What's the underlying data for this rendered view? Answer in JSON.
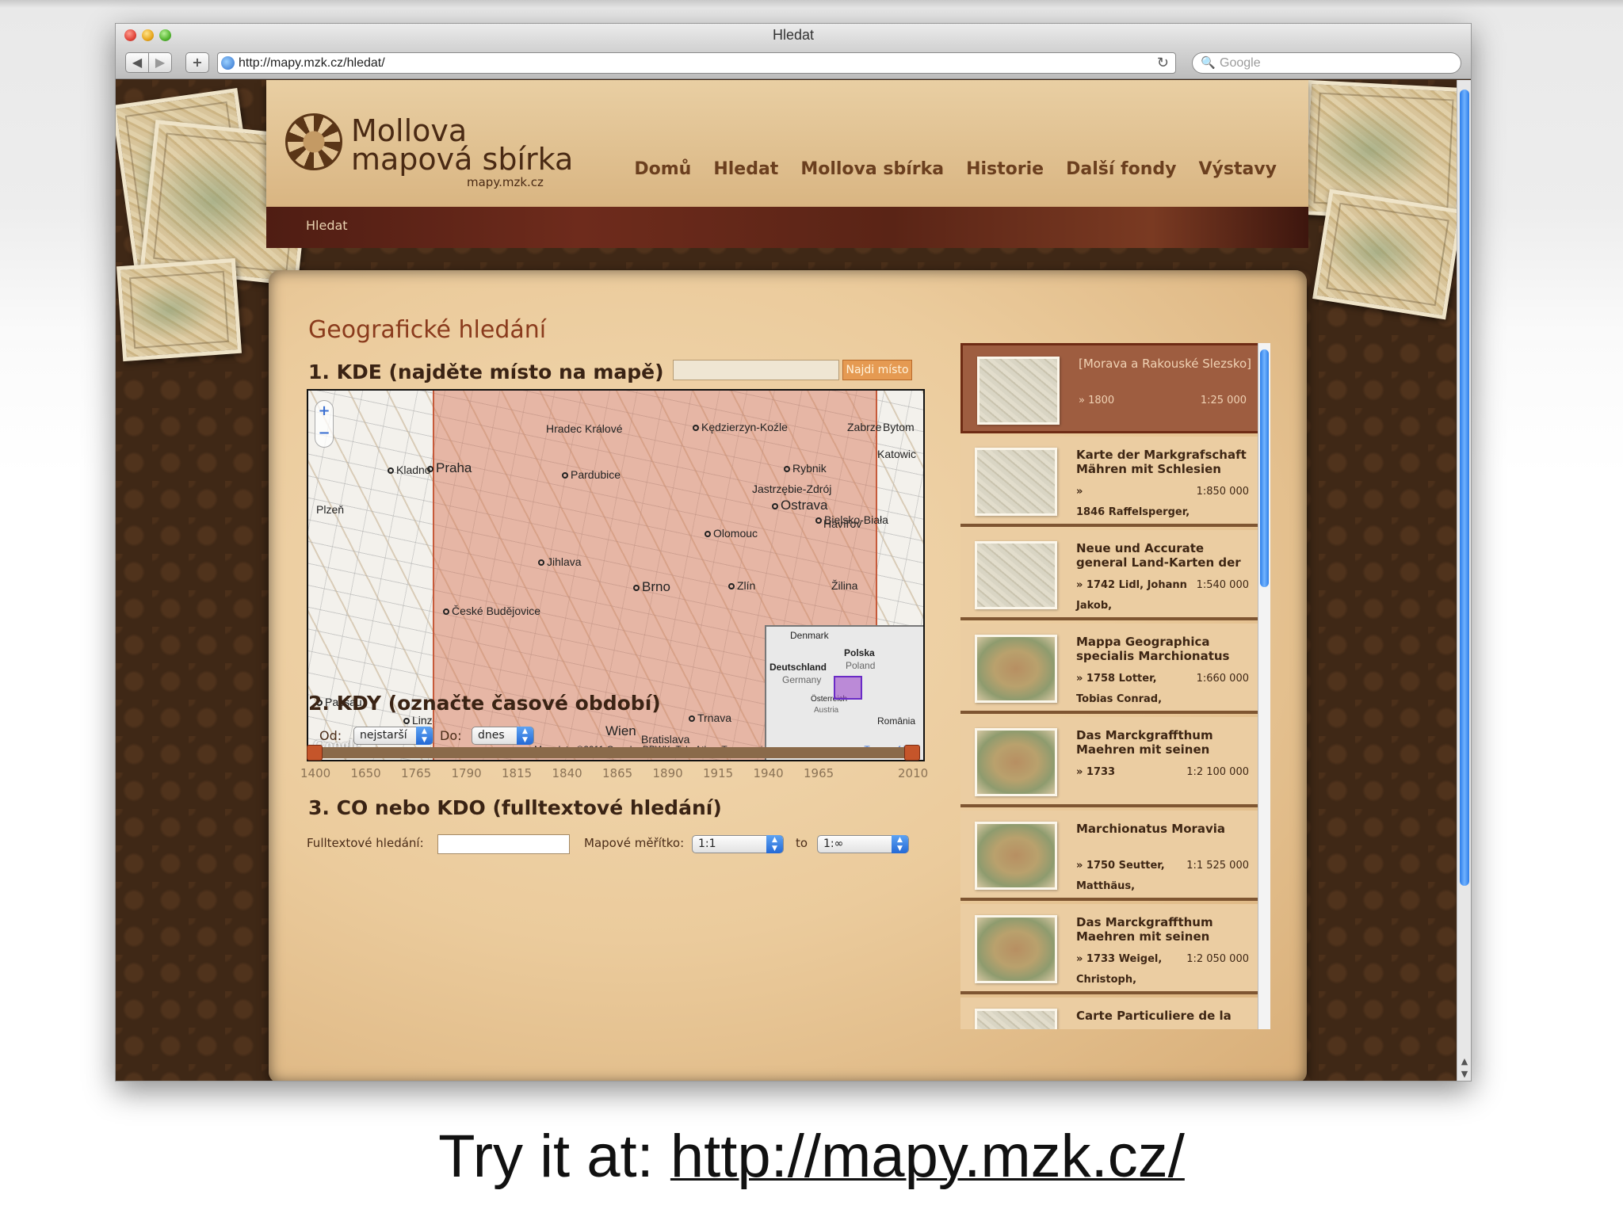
{
  "window": {
    "title": "Hledat",
    "url": "http://mapy.mzk.cz/hledat/",
    "search_placeholder": "Google"
  },
  "site": {
    "logo_line1": "Mollova",
    "logo_line2": "mapová sbírka",
    "logo_url": "mapy.mzk.cz",
    "nav": [
      "Domů",
      "Hledat",
      "Mollova sbírka",
      "Historie",
      "Další fondy",
      "Výstavy"
    ],
    "breadcrumb": "Hledat"
  },
  "search": {
    "heading": "Geografické hledání",
    "section1": "1. KDE (najděte místo na mapě)",
    "find_button": "Najdi místo",
    "section2": "2. KDY (označte časové období)",
    "from_label": "Od:",
    "from_value": "nejstarší",
    "to_label": "Do:",
    "to_value": "dnes",
    "timeline_ticks": [
      "1400",
      "1650",
      "1765",
      "1790",
      "1815",
      "1840",
      "1865",
      "1890",
      "1915",
      "1940",
      "1965",
      "2010"
    ],
    "section3": "3. CO nebo KDO (fulltextové hledání)",
    "fulltext_label": "Fulltextové hledání:",
    "scale_label": "Mapové měřítko:",
    "scale_from": "1:1",
    "scale_to_label": "to",
    "scale_to": "1:∞"
  },
  "map": {
    "zoom_in": "+",
    "zoom_out": "−",
    "attribution": "Map data ©2011 Google, PPWK, Tele Atlas, Transnavicom -",
    "terms": "Terms of Use",
    "google": "Google",
    "cities": [
      {
        "name": "Praha",
        "big": true,
        "dot": true
      },
      {
        "name": "Kladno",
        "big": false,
        "dot": true
      },
      {
        "name": "Plzeň",
        "big": false,
        "dot": false
      },
      {
        "name": "Hradec Králové",
        "big": false,
        "dot": false
      },
      {
        "name": "Pardubice",
        "big": false,
        "dot": true
      },
      {
        "name": "Kędzierzyn-Koźle",
        "big": false,
        "dot": true
      },
      {
        "name": "Zabrze",
        "big": false,
        "dot": false
      },
      {
        "name": "Bytom",
        "big": false,
        "dot": false
      },
      {
        "name": "Katowic",
        "big": false,
        "dot": false
      },
      {
        "name": "Rybnik",
        "big": false,
        "dot": true
      },
      {
        "name": "Jastrzębie-Zdrój",
        "big": false,
        "dot": false
      },
      {
        "name": "Ostrava",
        "big": true,
        "dot": true
      },
      {
        "name": "Bielsko-Biała",
        "big": false,
        "dot": true
      },
      {
        "name": "Havířov",
        "big": false,
        "dot": false
      },
      {
        "name": "Olomouc",
        "big": false,
        "dot": true
      },
      {
        "name": "Jihlava",
        "big": false,
        "dot": true
      },
      {
        "name": "Brno",
        "big": true,
        "dot": true
      },
      {
        "name": "Zlín",
        "big": false,
        "dot": true
      },
      {
        "name": "Žilina",
        "big": false,
        "dot": false
      },
      {
        "name": "České Budějovice",
        "big": false,
        "dot": true
      },
      {
        "name": "Passau",
        "big": false,
        "dot": true
      },
      {
        "name": "Linz",
        "big": false,
        "dot": true
      },
      {
        "name": "Wien",
        "big": true,
        "dot": false
      },
      {
        "name": "Bratislava",
        "big": false,
        "dot": false
      },
      {
        "name": "Trnava",
        "big": false,
        "dot": true
      }
    ],
    "overview_labels": [
      "Polska",
      "Poland",
      "Deutschland",
      "Germany",
      "Österreich",
      "Austria",
      "România",
      "Denmark"
    ]
  },
  "results": [
    {
      "title": "[Morava a Rakouské Slezsko]",
      "year": "» 1800",
      "scale": "1:25 000",
      "line2": "",
      "selected": true,
      "color_thumb": false
    },
    {
      "title": "Karte der Markgrafschaft Mähren mit Schlesien",
      "year": "»",
      "scale": "1:850 000",
      "line2": "1846 Raffelsperger,",
      "selected": false,
      "color_thumb": false
    },
    {
      "title": "Neue und Accurate general Land-Karten der",
      "year": "» 1742 Lidl, Johann",
      "scale": "1:540 000",
      "line2": "Jakob,",
      "selected": false,
      "color_thumb": false
    },
    {
      "title": "Mappa Geographica specialis Marchionatus",
      "year": "» 1758 Lotter,",
      "scale": "1:660 000",
      "line2": "Tobias Conrad,",
      "selected": false,
      "color_thumb": true
    },
    {
      "title": "Das Marckgraffthum Maehren mit seinen",
      "year": "» 1733",
      "scale": "1:2 100 000",
      "line2": "",
      "selected": false,
      "color_thumb": true
    },
    {
      "title": "Marchionatus Moravia",
      "year": "» 1750 Seutter,",
      "scale": "1:1 525 000",
      "line2": "Matthäus,",
      "selected": false,
      "color_thumb": true
    },
    {
      "title": "Das Marckgraffthum Maehren mit seinen",
      "year": "» 1733 Weigel,",
      "scale": "1:2 050 000",
      "line2": "Christoph,",
      "selected": false,
      "color_thumb": true
    },
    {
      "title": "Carte Particuliere de la",
      "year": "",
      "scale": "",
      "line2": "",
      "selected": false,
      "color_thumb": false
    }
  ],
  "caption": {
    "prefix": "Try it at:",
    "link": "http://mapy.mzk.cz/"
  }
}
